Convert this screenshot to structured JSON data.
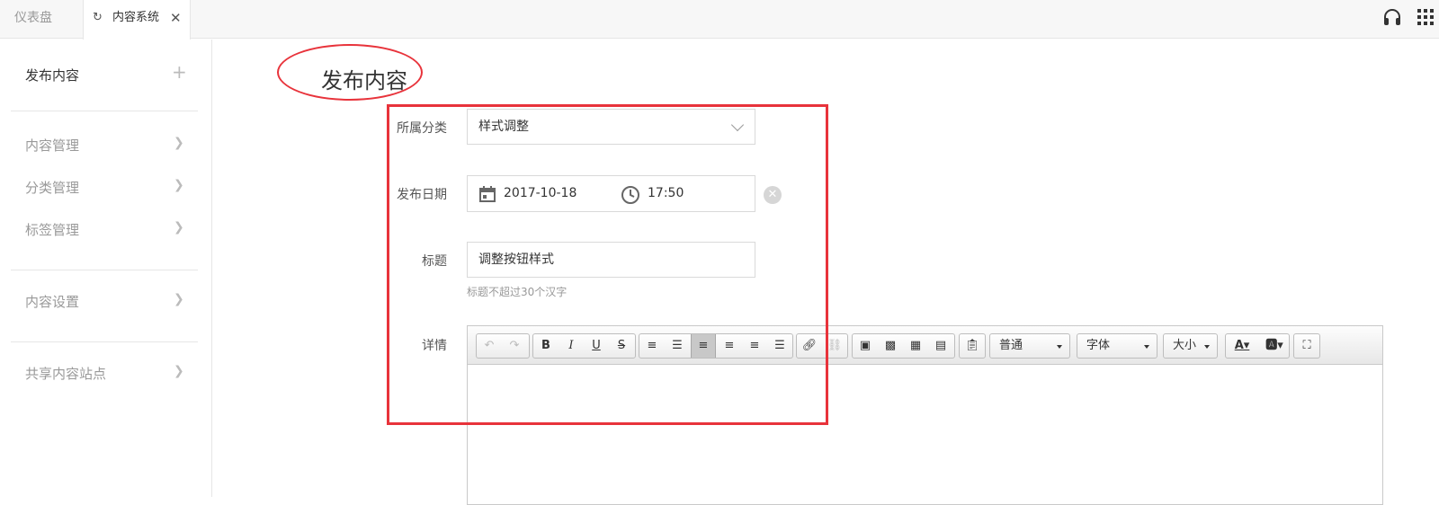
{
  "tabs": {
    "dashboard": "仪表盘",
    "content_system": "内容系统",
    "refresh_icon": "refresh-icon",
    "close_icon": "close-icon"
  },
  "header": {
    "icons": [
      "headset-icon",
      "apps-grid-icon"
    ]
  },
  "sidebar": {
    "items": [
      {
        "label": "发布内容",
        "active": true,
        "icon": "plus-icon"
      },
      {
        "label": "内容管理",
        "icon": "chevron-right-icon"
      },
      {
        "label": "分类管理",
        "icon": "chevron-right-icon"
      },
      {
        "label": "标签管理",
        "icon": "chevron-right-icon"
      },
      {
        "label": "内容设置",
        "icon": "chevron-right-icon"
      },
      {
        "label": "共享内容站点",
        "icon": "chevron-right-icon"
      }
    ]
  },
  "page": {
    "title": "发布内容"
  },
  "form": {
    "category": {
      "label": "所属分类",
      "value": "样式调整"
    },
    "publish_date": {
      "label": "发布日期",
      "date": "2017-10-18",
      "time": "17:50"
    },
    "title": {
      "label": "标题",
      "value": "调整按钮样式",
      "hint": "标题不超过30个汉字"
    },
    "details": {
      "label": "详情"
    }
  },
  "editor": {
    "toolbar": {
      "paragraph": "普通",
      "font": "字体",
      "size": "大小",
      "bold": "B",
      "italic": "I",
      "underline": "U",
      "strike": "S"
    }
  },
  "colors": {
    "highlight": "#e8333b",
    "border": "#d9d9d9"
  }
}
